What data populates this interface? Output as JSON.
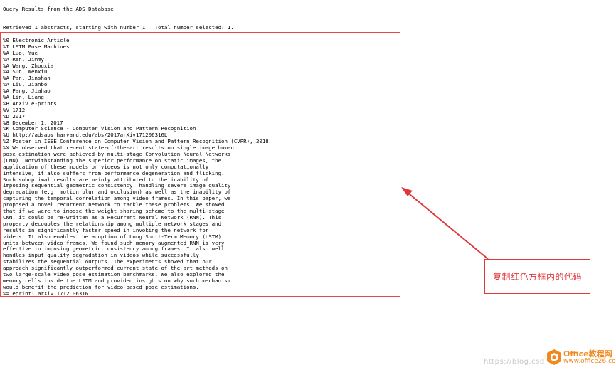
{
  "page": {
    "title": "Query Results from the ADS Database",
    "summary": "Retrieved 1 abstracts, starting with number 1.  Total number selected: 1."
  },
  "record": {
    "lines": [
      "%0 Electronic Article",
      "%T LSTM Pose Machines",
      "%A Luo, Yue",
      "%A Ren, Jimmy",
      "%A Wang, Zhouxia",
      "%A Sun, Wenxiu",
      "%A Pan, Jinshan",
      "%A Liu, Jianbo",
      "%A Pang, Jiahao",
      "%A Lin, Liang",
      "%B ArXiv e-prints",
      "%V 1712",
      "%D 2017",
      "%8 December 1, 2017",
      "%K Computer Science - Computer Vision and Pattern Recognition",
      "%U http://adsabs.harvard.edu/abs/2017arXiv171206316L",
      "%Z Poster in IEEE Conference on Computer Vision and Pattern Recognition (CVPR), 2018",
      "%X We observed that recent state-of-the-art results on single image human",
      "pose estimation were achieved by multi-stage Convolution Neural Networks",
      "(CNN). Notwithstanding the superior performance on static images, the",
      "application of these models on videos is not only computationally",
      "intensive, it also suffers from performance degeneration and flicking.",
      "Such suboptimal results are mainly attributed to the inability of",
      "imposing sequential geometric consistency, handling severe image quality",
      "degradation (e.g. motion blur and occlusion) as well as the inability of",
      "capturing the temporal correlation among video frames. In this paper, we",
      "proposed a novel recurrent network to tackle these problems. We showed",
      "that if we were to impose the weight sharing scheme to the multi-stage",
      "CNN, it could be re-written as a Recurrent Neural Network (RNN). This",
      "property decouples the relationship among multiple network stages and",
      "results in significantly faster speed in invoking the network for",
      "videos. It also enables the adoption of Long Short-Term Memory (LSTM)",
      "units between video frames. We found such memory augmented RNN is very",
      "effective in imposing geometric consistency among frames. It also well",
      "handles input quality degradation in videos while successfully",
      "stabilizes the sequential outputs. The experiments showed that our",
      "approach significantly outperformed current state-of-the-art methods on",
      "two large-scale video pose estimation benchmarks. We also explored the",
      "memory cells inside the LSTM and provided insights on why such mechanism",
      "would benefit the prediction for video-based pose estimations.",
      "%= eprint: arXiv:1712.06316"
    ]
  },
  "annotation": {
    "callout_text": "复制红色方框内的代码",
    "color": "#e0383b"
  },
  "watermark": {
    "url": "https://blog.csd",
    "brand_name": "Office教程网",
    "brand_site": "www.office26.com",
    "brand_color": "#f08a1f"
  }
}
